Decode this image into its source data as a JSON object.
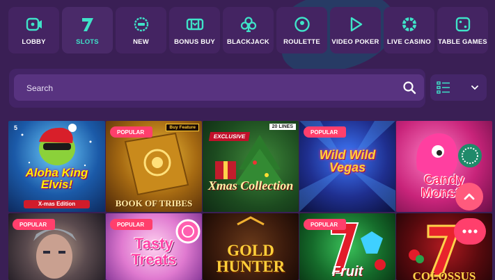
{
  "categories": [
    {
      "label": "LOBBY",
      "icon": "lobby-icon",
      "active": false
    },
    {
      "label": "SLOTS",
      "icon": "slots-seven-icon",
      "active": true
    },
    {
      "label": "NEW",
      "icon": "new-icon",
      "active": false
    },
    {
      "label": "BONUS BUY",
      "icon": "bonus-buy-icon",
      "active": false
    },
    {
      "label": "BLACKJACK",
      "icon": "club-icon",
      "active": false
    },
    {
      "label": "ROULETTE",
      "icon": "roulette-icon",
      "active": false
    },
    {
      "label": "VIDEO POKER",
      "icon": "play-icon",
      "active": false
    },
    {
      "label": "LIVE CASINO",
      "icon": "live-casino-icon",
      "active": false
    },
    {
      "label": "TABLE GAMES",
      "icon": "dice-icon",
      "active": false
    }
  ],
  "search": {
    "placeholder": "Search"
  },
  "games": [
    {
      "title": "Aloha King Elvis!",
      "subtitle": "X-mas Edition",
      "badge": "",
      "corner_tag": "5"
    },
    {
      "title": "BOOK OF TRIBES",
      "subtitle": "",
      "badge": "POPULAR",
      "corner_tag": "Buy Feature"
    },
    {
      "title": "Xmas Collection",
      "subtitle": "",
      "badge": "EXCLUSIVE",
      "corner_tag": "20 LINES"
    },
    {
      "title": "Wild Wild Vegas",
      "subtitle": "",
      "badge": "POPULAR",
      "corner_tag": ""
    },
    {
      "title": "Candy Monsta",
      "subtitle": "",
      "badge": "",
      "corner_tag": ""
    },
    {
      "title": "",
      "subtitle": "",
      "badge": "POPULAR",
      "corner_tag": ""
    },
    {
      "title": "Tasty Treats",
      "subtitle": "",
      "badge": "POPULAR",
      "corner_tag": ""
    },
    {
      "title": "GOLD HUNTER",
      "subtitle": "",
      "badge": "",
      "corner_tag": ""
    },
    {
      "title": "Fruit",
      "subtitle": "",
      "badge": "POPULAR",
      "corner_tag": ""
    },
    {
      "title": "COLOSSUS",
      "subtitle": "",
      "badge": "",
      "corner_tag": ""
    }
  ],
  "colors": {
    "background": "#3a1f55",
    "accent": "#3fe3c8",
    "badge": "#ff3f6c"
  }
}
